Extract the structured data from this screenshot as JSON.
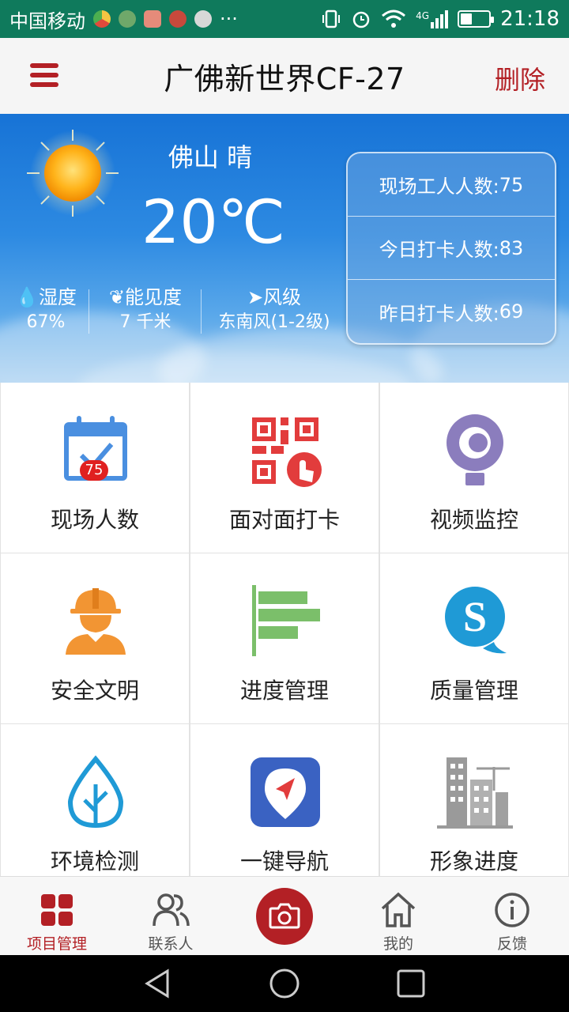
{
  "status_bar": {
    "carrier": "中国移动",
    "more": "···",
    "network": "4G",
    "time": "21:18"
  },
  "app_bar": {
    "title": "广佛新世界CF-27",
    "delete_label": "删除"
  },
  "weather": {
    "city_condition": "佛山 晴",
    "temperature": "20℃",
    "humidity_label": "湿度",
    "humidity_value": "67%",
    "visibility_label": "能见度",
    "visibility_value": "7 千米",
    "wind_label": "风级",
    "wind_value": "东南风(1-2级)"
  },
  "stats": [
    {
      "label": "现场工人人数:",
      "value": "75"
    },
    {
      "label": "今日打卡人数:",
      "value": "83"
    },
    {
      "label": "昨日打卡人数:",
      "value": "69"
    }
  ],
  "grid": [
    {
      "label": "现场人数",
      "icon": "calendar-check-icon",
      "badge": "75"
    },
    {
      "label": "面对面打卡",
      "icon": "qr-code-tap-icon"
    },
    {
      "label": "视频监控",
      "icon": "webcam-icon"
    },
    {
      "label": "安全文明",
      "icon": "worker-helmet-icon"
    },
    {
      "label": "进度管理",
      "icon": "progress-bars-icon"
    },
    {
      "label": "质量管理",
      "icon": "quality-s-icon"
    },
    {
      "label": "环境检测",
      "icon": "leaf-drop-icon"
    },
    {
      "label": "一键导航",
      "icon": "navigation-pin-icon"
    },
    {
      "label": "形象进度",
      "icon": "buildings-crane-icon"
    }
  ],
  "bottom_nav": [
    {
      "label": "项目管理",
      "icon": "grid-icon",
      "active": true
    },
    {
      "label": "联系人",
      "icon": "contacts-icon"
    },
    {
      "label": "",
      "icon": "camera-icon"
    },
    {
      "label": "我的",
      "icon": "home-icon"
    },
    {
      "label": "反馈",
      "icon": "info-icon"
    }
  ],
  "colors": {
    "accent": "#b32025",
    "status_bar": "#0f7a5c",
    "weather_top": "#1773d6",
    "icon_blue": "#4a8fe0",
    "icon_orange": "#f29533",
    "icon_green": "#7bbf6a",
    "icon_cyan": "#1f9ad6",
    "icon_purple": "#8b7dbd",
    "icon_red": "#e23c3c"
  }
}
